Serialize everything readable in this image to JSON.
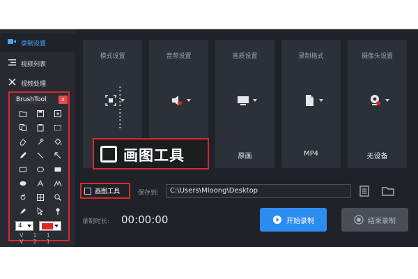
{
  "sidebar": {
    "items": [
      {
        "label": "录制设置",
        "icon": "camera-icon"
      },
      {
        "label": "视频列表",
        "icon": "list-icon"
      },
      {
        "label": "视频处理",
        "icon": "tools-icon"
      }
    ]
  },
  "brushtool": {
    "title": "BrushTool",
    "close": "x",
    "size_value": "4",
    "color": "#e22525",
    "bottom_text": "V11 V21"
  },
  "cards": [
    {
      "label": "模式设置",
      "value": "",
      "icon": "fullscreen-icon"
    },
    {
      "label": "音频设置",
      "value": "",
      "icon": "speaker-icon"
    },
    {
      "label": "画质设置",
      "value": "原画",
      "icon": "monitor-icon"
    },
    {
      "label": "录制格式",
      "value": "MP4",
      "icon": "file-icon"
    },
    {
      "label": "摄像头设置",
      "value": "无设备",
      "icon": "webcam-icon"
    }
  ],
  "callout": {
    "text": "画图工具"
  },
  "bottom": {
    "draw_tool_label": "画图工具",
    "save_label": "保存到:",
    "save_path": "C:\\Users\\Mloong\\Desktop",
    "time_label": "录制时长:",
    "time_value": "00:00:00",
    "start_label": "开始录制",
    "end_label": "结束录制"
  },
  "colors": {
    "accent": "#2d8cf0",
    "highlight": "#d8282f",
    "background": "#1f2228"
  }
}
